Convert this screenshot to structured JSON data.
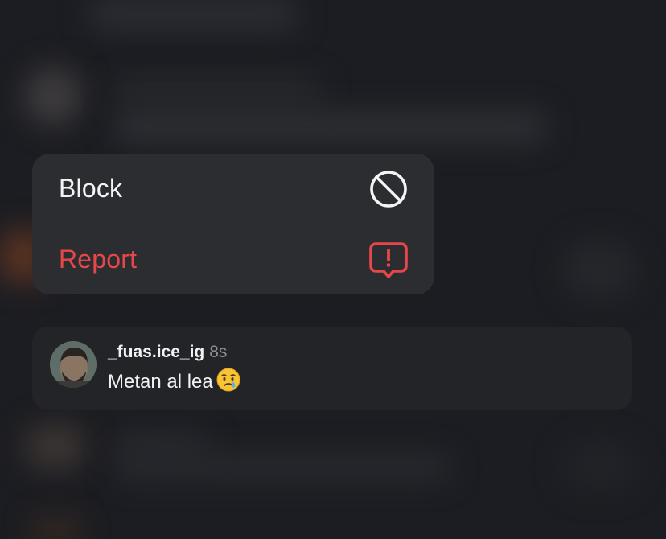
{
  "menu": {
    "items": [
      {
        "label": "Block",
        "icon": "block-icon",
        "color": "#f4f4f5"
      },
      {
        "label": "Report",
        "icon": "report-icon",
        "color": "#e8474a"
      }
    ]
  },
  "comment": {
    "username": "_fuas.ice_ig",
    "time": "8s",
    "text": "Metan al lea",
    "emoji": "crying-face-emoji"
  },
  "colors": {
    "background": "#1c1d22",
    "menu_background": "#2c2d31",
    "danger": "#e8474a"
  }
}
